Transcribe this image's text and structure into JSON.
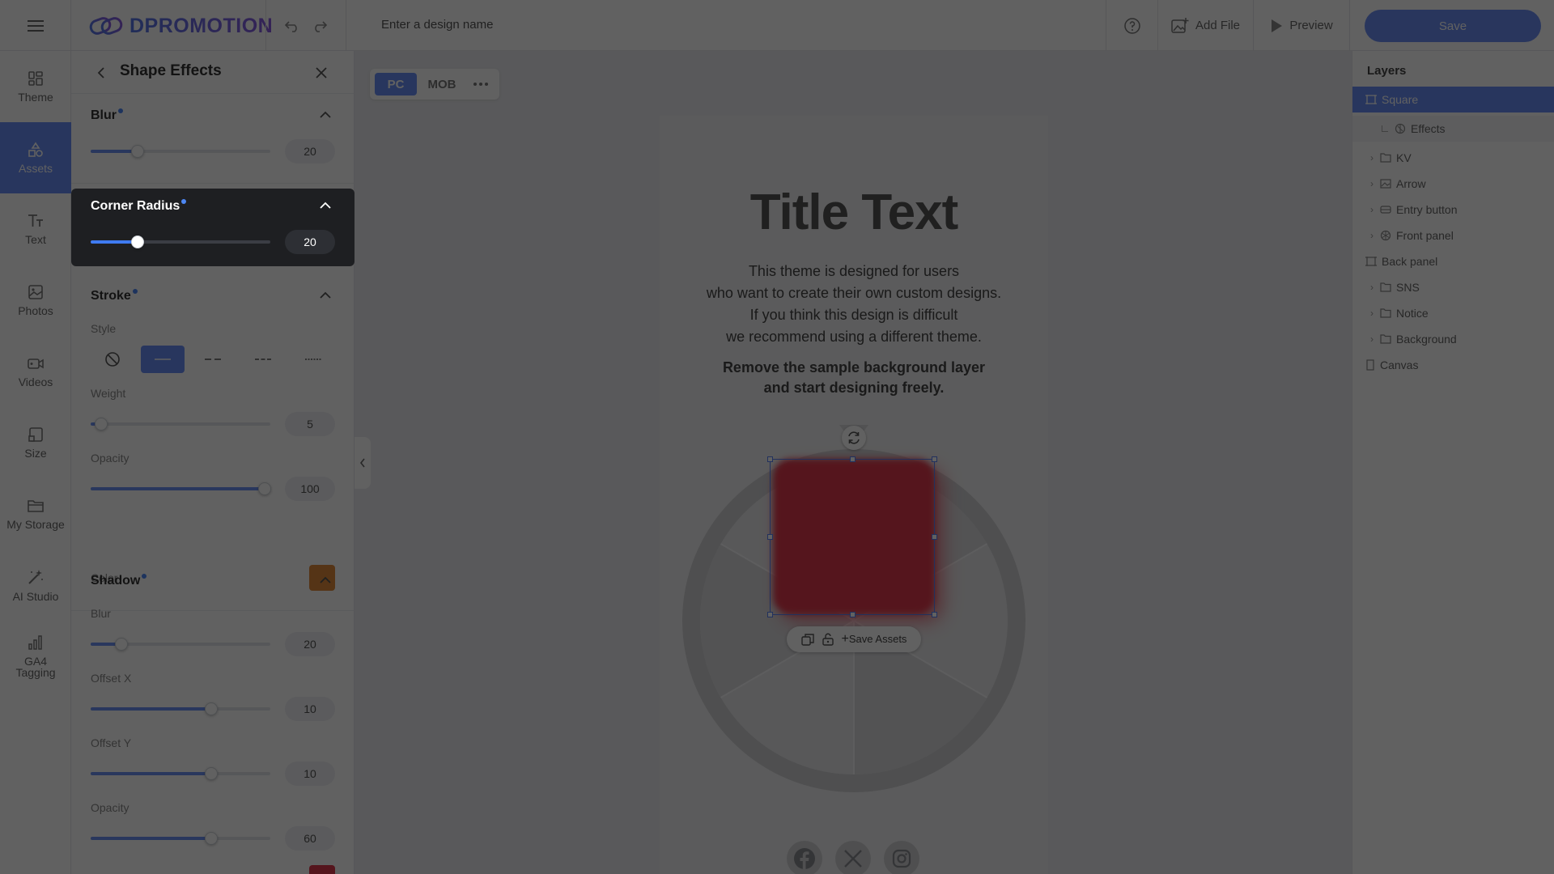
{
  "app": {
    "brand": "DPROMOTION",
    "design_name_placeholder": "Enter a design name"
  },
  "topbar": {
    "add_file": "Add File",
    "preview": "Preview",
    "save": "Save"
  },
  "rail": [
    {
      "label": "Theme",
      "icon": "theme-icon"
    },
    {
      "label": "Assets",
      "icon": "assets-icon",
      "active": true
    },
    {
      "label": "Text",
      "icon": "text-icon"
    },
    {
      "label": "Photos",
      "icon": "photos-icon"
    },
    {
      "label": "Videos",
      "icon": "videos-icon"
    },
    {
      "label": "Size",
      "icon": "size-icon"
    },
    {
      "label": "My Storage",
      "icon": "folder-icon"
    },
    {
      "label": "AI Studio",
      "icon": "magic-wand-icon"
    },
    {
      "label": "GA4 Tagging",
      "icon": "bar-chart-icon"
    }
  ],
  "panel": {
    "title": "Shape Effects",
    "blur": {
      "title": "Blur",
      "value": "20",
      "level": 0.26
    },
    "corner_radius": {
      "title": "Corner Radius",
      "value": "20",
      "level": 0.26
    },
    "stroke": {
      "title": "Stroke",
      "style_label": "Style",
      "weight_label": "Weight",
      "weight_value": "5",
      "weight_level": 0.06,
      "opacity_label": "Opacity",
      "opacity_value": "100",
      "opacity_level": 0.97,
      "color_label": "Color",
      "color": "#e08a3c"
    },
    "shadow": {
      "title": "Shadow",
      "blur_label": "Blur",
      "blur_value": "20",
      "blur_level": 0.17,
      "offset_x_label": "Offset X",
      "offset_x_value": "10",
      "offset_x_level": 0.67,
      "offset_y_label": "Offset Y",
      "offset_y_value": "10",
      "offset_y_level": 0.67,
      "opacity_label": "Opacity",
      "opacity_value": "60",
      "opacity_level": 0.67,
      "color": "#e0394c"
    }
  },
  "device_tabs": {
    "pc": "PC",
    "mob": "MOB"
  },
  "canvas": {
    "title": "Title Text",
    "body_lines": [
      "This theme is designed for users",
      "who want to create their own custom designs.",
      "If you think this design is difficult",
      "we recommend using a different theme."
    ],
    "bold_lines": [
      "Remove the sample background layer",
      "and start designing freely."
    ],
    "save_assets": "Save Assets",
    "square_color": "#e0394c"
  },
  "layers": {
    "title": "Layers",
    "items": [
      {
        "label": "Square",
        "selected": true
      },
      {
        "label": "Effects"
      },
      {
        "label": "KV"
      },
      {
        "label": "Arrow"
      },
      {
        "label": "Entry button"
      },
      {
        "label": "Front panel"
      },
      {
        "label": "Back panel"
      },
      {
        "label": "SNS"
      },
      {
        "label": "Notice"
      },
      {
        "label": "Background"
      },
      {
        "label": "Canvas"
      }
    ]
  }
}
